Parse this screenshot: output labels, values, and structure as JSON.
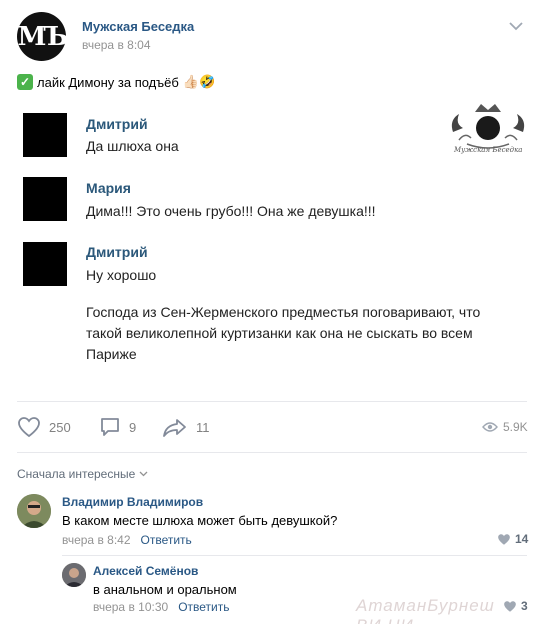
{
  "post": {
    "group_name": "Мужская Беседка",
    "time": "вчера в 8:04",
    "avatar_text": "МЪ",
    "text": "лайк Димону за подъёб",
    "check_icon": "✓",
    "emoji": "👍🏻🤣"
  },
  "chat": {
    "messages": [
      {
        "author": "Дмитрий",
        "lines": [
          "Да шлюха она"
        ]
      },
      {
        "author": "Мария",
        "lines": [
          "Дима!!! Это очень грубо!!! Она же девушка!!!"
        ]
      },
      {
        "author": "Дмитрий",
        "lines": [
          "Ну хорошо",
          "Господа из Сен-Жерменского предместья поговаривают, что",
          "такой великолепной куртизанки как она не сыскать во всем",
          "Париже"
        ]
      }
    ],
    "watermark_caption": "Мужская Беседка"
  },
  "actions": {
    "likes": "250",
    "comments": "9",
    "shares": "11",
    "views": "5.9K"
  },
  "comments_section": {
    "sort_label": "Сначала интересные",
    "items": [
      {
        "author": "Владимир Владимиров",
        "text": "В каком месте шлюха может быть девушкой?",
        "time": "вчера в 8:42",
        "reply": "Ответить",
        "likes": "14"
      },
      {
        "author": "Алексей Семёнов",
        "text": "в анальном и оральном",
        "time": "вчера в 10:30",
        "reply": "Ответить",
        "likes": "3"
      }
    ]
  },
  "watermark_site": "АтаманБурнеш ВИ.НИ",
  "colors": {
    "link": "#2a5885",
    "muted": "#939393",
    "check": "#4bb34b"
  }
}
